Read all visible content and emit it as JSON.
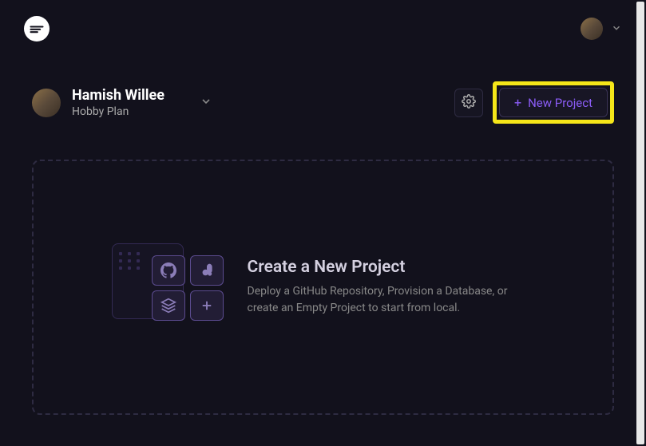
{
  "topbar": {
    "logo_alt": "Railway logo"
  },
  "account": {
    "name": "Hamish Willee",
    "plan": "Hobby Plan"
  },
  "actions": {
    "new_project_label": "New Project"
  },
  "empty_state": {
    "title": "Create a New Project",
    "description": "Deploy a GitHub Repository, Provision a Database, or create an Empty Project to start from local."
  }
}
